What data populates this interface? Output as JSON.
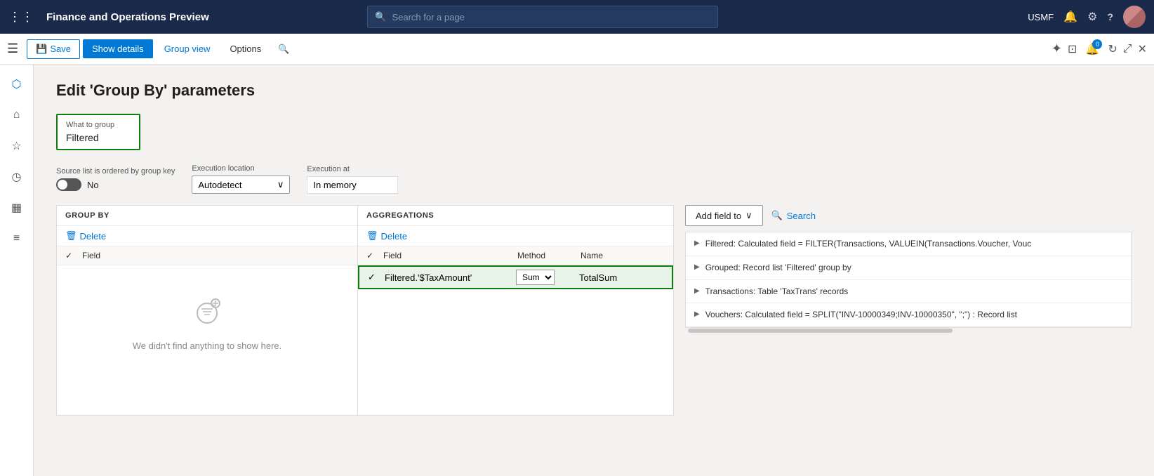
{
  "app": {
    "title": "Finance and Operations Preview",
    "search_placeholder": "Search for a page",
    "org": "USMF"
  },
  "toolbar": {
    "save_label": "Save",
    "show_details_label": "Show details",
    "group_view_label": "Group view",
    "options_label": "Options",
    "notifications_badge": "0"
  },
  "page": {
    "title": "Edit 'Group By' parameters"
  },
  "what_to_group": {
    "label": "What to group",
    "value": "Filtered"
  },
  "source_list": {
    "label": "Source list is ordered by group key",
    "toggle_value": "No"
  },
  "execution_location": {
    "label": "Execution location",
    "value": "Autodetect"
  },
  "execution_at": {
    "label": "Execution at",
    "value": "In memory"
  },
  "group_by": {
    "header": "GROUP BY",
    "delete_label": "Delete",
    "field_col": "Field",
    "empty_message": "We didn't find anything to show here."
  },
  "aggregations": {
    "header": "AGGREGATIONS",
    "delete_label": "Delete",
    "check_col": "",
    "field_col": "Field",
    "method_col": "Method",
    "name_col": "Name",
    "row": {
      "field": "Filtered.'$TaxAmount'",
      "method": "Sum",
      "name": "TotalSum"
    }
  },
  "right_panel": {
    "add_field_to": "Add field to",
    "search": "Search",
    "data_sources": [
      {
        "text": "Filtered: Calculated field = FILTER(Transactions, VALUEIN(Transactions.Voucher, Vouc"
      },
      {
        "text": "Grouped: Record list 'Filtered' group by"
      },
      {
        "text": "Transactions: Table 'TaxTrans' records"
      },
      {
        "text": "Vouchers: Calculated field = SPLIT(\"INV-10000349;INV-10000350\", \";\") : Record list"
      }
    ]
  },
  "icons": {
    "grid": "⊞",
    "search": "🔍",
    "bell": "🔔",
    "gear": "⚙",
    "help": "?",
    "hamburger": "☰",
    "save": "💾",
    "filter": "⬡",
    "home": "⌂",
    "star": "☆",
    "clock": "◷",
    "calendar": "▦",
    "list": "≡",
    "close": "✕",
    "chevron_down": "∨",
    "chevron_right": "›",
    "delete_trash": "🗑",
    "checkmark": "✓",
    "arrow_right": "▶",
    "settings2": "⚙",
    "split": "⊡",
    "refresh": "↻",
    "expand": "⤢"
  }
}
